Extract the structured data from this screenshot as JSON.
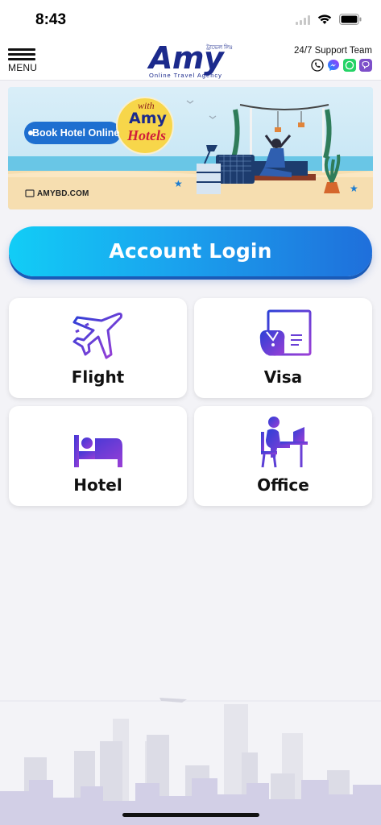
{
  "status_bar": {
    "time": "8:43"
  },
  "header": {
    "menu_label": "MENU",
    "logo_name": "Amy",
    "logo_bangla": "ট্রাভেল লিঃ",
    "logo_tagline": "Online Travel Agency",
    "support_title": "24/7 Support Team",
    "support_icons": [
      "phone-icon",
      "messenger-icon",
      "whatsapp-icon",
      "viber-icon"
    ]
  },
  "banner": {
    "headline": "Book Hotel Online",
    "badge_with": "with",
    "badge_brand": "Amy",
    "badge_sub": "Hotels",
    "site": "AMYBD.COM"
  },
  "login": {
    "label": "Account Login"
  },
  "services": [
    {
      "label": "Flight",
      "icon": "airplane-icon"
    },
    {
      "label": "Visa",
      "icon": "visa-document-icon"
    },
    {
      "label": "Hotel",
      "icon": "bed-icon"
    },
    {
      "label": "Office",
      "icon": "office-desk-icon"
    }
  ],
  "colors": {
    "brand": "#1b2a8c",
    "accent_start": "#12cdf6",
    "accent_end": "#1f6fdb",
    "icon_blue": "#2b3fd6",
    "icon_purple": "#8a3fd6"
  }
}
